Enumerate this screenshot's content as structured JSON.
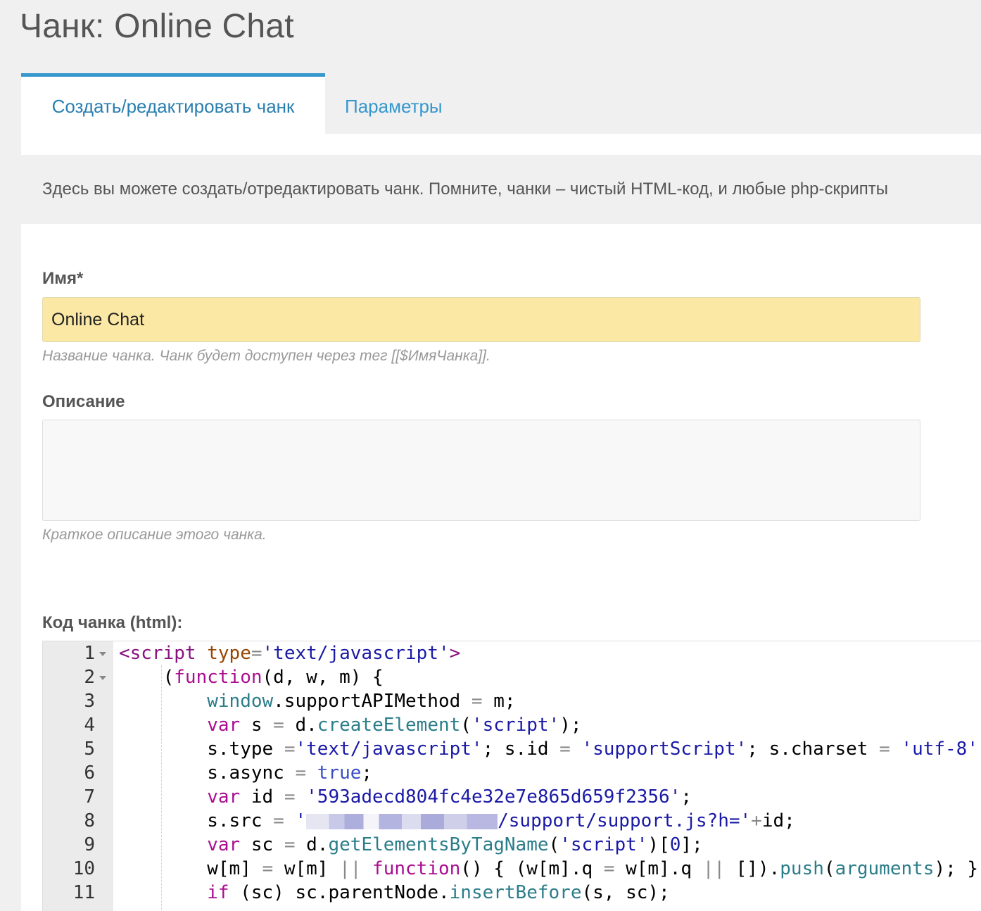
{
  "title": "Чанк: Online Chat",
  "tabs": [
    {
      "label": "Создать/редактировать чанк",
      "active": true
    },
    {
      "label": "Параметры",
      "active": false
    }
  ],
  "intro": "Здесь вы можете создать/отредактировать чанк. Помните, чанки – чистый HTML-код, и любые php-скрипты",
  "fields": {
    "name": {
      "label": "Имя*",
      "value": "Online Chat",
      "hint": "Название чанка. Чанк будет доступен через тег [[$ИмяЧанка]]."
    },
    "description": {
      "label": "Описание",
      "value": "",
      "hint": "Краткое описание этого чанка."
    }
  },
  "code_label": "Код чанка (html):",
  "code": {
    "line_numbers": [
      "1",
      "2",
      "3",
      "4",
      "5",
      "6",
      "7",
      "8",
      "9",
      "10",
      "11"
    ],
    "tokens": {
      "l1_tag": "<script",
      "l1_attr": "type",
      "l1_eq": "=",
      "l1_str": "'text/javascript'",
      "l1_end": ">",
      "l2_open": "(",
      "l2_fn": "function",
      "l2_rest": "(d, w, m) {",
      "l3_win": "window",
      "l3_rest": ".supportAPIMethod ",
      "l3_eq": "=",
      "l3_m": " m;",
      "l4_var": "var",
      "l4_s": " s ",
      "l4_eq": "=",
      "l4_d": " d.",
      "l4_ce": "createElement",
      "l4_p": "(",
      "l4_str": "'script'",
      "l4_end": ");",
      "l5_a": "s.type ",
      "l5_eq1": "=",
      "l5_str1": "'text/javascript'",
      "l5_b": "; s.id ",
      "l5_eq2": "=",
      "l5_str2": " 'supportScript'",
      "l5_c": "; s.charset ",
      "l5_eq3": "=",
      "l5_str3": " 'utf-8'",
      "l5_d": ";",
      "l6_a": "s.async ",
      "l6_eq": "=",
      "l6_true": " true",
      "l6_end": ";",
      "l7_var": "var",
      "l7_id": " id ",
      "l7_eq": "=",
      "l7_str": " '593adecd804fc4e32e7e865d659f2356'",
      "l7_end": ";",
      "l8_a": "s.src ",
      "l8_eq": "=",
      "l8_q": " '",
      "l8_str": "/support/support.js?h='",
      "l8_op": "+",
      "l8_end": "id;",
      "l9_var": "var",
      "l9_sc": " sc ",
      "l9_eq": "=",
      "l9_d": " d.",
      "l9_fn": "getElementsByTagName",
      "l9_p": "(",
      "l9_str": "'script'",
      "l9_idx": ")[",
      "l9_zero": "0",
      "l9_end": "];",
      "l10_a": "w[m] ",
      "l10_eq": "=",
      "l10_b": " w[m] ",
      "l10_or": "||",
      "l10_fn": " function",
      "l10_c": "() { (w[m].q ",
      "l10_eq2": "=",
      "l10_d": " w[m].q ",
      "l10_or2": "||",
      "l10_e": " []).",
      "l10_push": "push",
      "l10_f": "(",
      "l10_args": "arguments",
      "l10_g": "); };",
      "l11_if": "if",
      "l11_a": " (sc) sc.",
      "l11_pn": "parentNode",
      "l11_dot": ".",
      "l11_ib": "insertBefore",
      "l11_end": "(s, sc);"
    }
  },
  "colors": {
    "accent": "#3697cd",
    "name_input_bg": "#fbe8a4",
    "page_bg": "#f0f0f0"
  }
}
